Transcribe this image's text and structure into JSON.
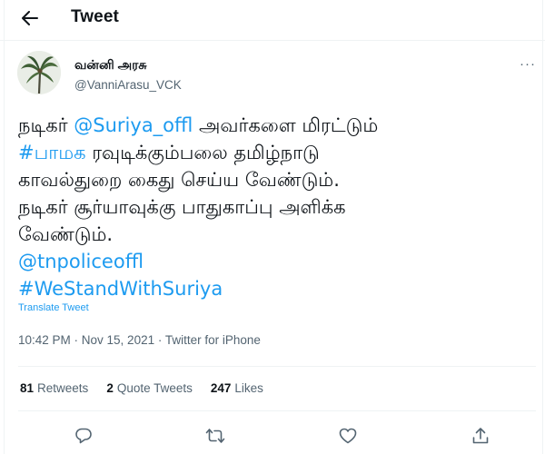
{
  "header": {
    "title": "Tweet"
  },
  "author": {
    "name": "வன்னி அரசு",
    "handle": "@VanniArasu_VCK"
  },
  "tweet": {
    "lines": [
      [
        {
          "text": "நடிகர் ",
          "link": false
        },
        {
          "text": "@Suriya_offl",
          "link": true
        },
        {
          "text": " அவர்களை மிரட்டும்",
          "link": false
        }
      ],
      [
        {
          "text": "#பாமக",
          "link": true
        },
        {
          "text": " ரவுடிக்கும்பலை தமிழ்நாடு",
          "link": false
        }
      ],
      [
        {
          "text": "காவல்துறை கைது செய்ய வேண்டும்.",
          "link": false
        }
      ],
      [
        {
          "text": "நடிகர் சூர்யாவுக்கு பாதுகாப்பு அளிக்க",
          "link": false
        }
      ],
      [
        {
          "text": "வேண்டும்.",
          "link": false
        }
      ],
      [
        {
          "text": "@tnpoliceoffl",
          "link": true
        }
      ],
      [
        {
          "text": "#WeStandWithSuriya",
          "link": true
        }
      ]
    ],
    "translate_label": "Translate Tweet",
    "time": "10:42 PM · Nov 15, 2021 · ",
    "source": "Twitter for iPhone"
  },
  "stats": {
    "retweets_count": "81",
    "retweets_label": "Retweets",
    "quotes_count": "2",
    "quotes_label": "Quote Tweets",
    "likes_count": "247",
    "likes_label": "Likes"
  },
  "icons": {
    "back": "arrow-left-icon",
    "more": "more-icon",
    "reply": "reply-icon",
    "retweet": "retweet-icon",
    "like": "heart-icon",
    "share": "share-icon"
  },
  "colors": {
    "link": "#1d9bf0",
    "secondary": "#536471",
    "text": "#0f1419",
    "border": "#eff3f4"
  }
}
